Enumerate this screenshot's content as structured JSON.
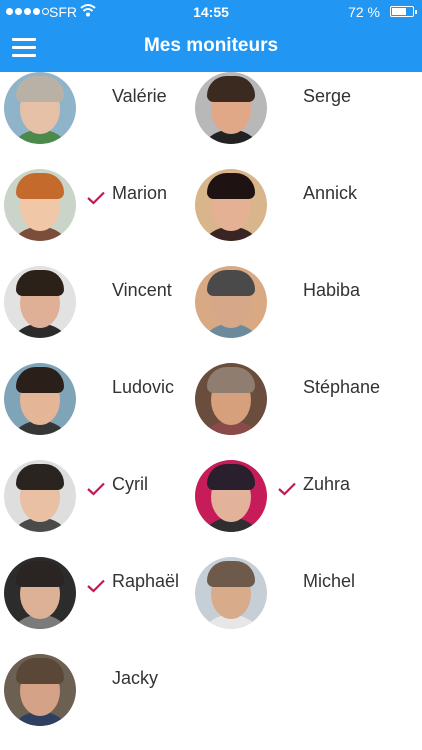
{
  "status": {
    "carrier": "SFR",
    "time": "14:55",
    "battery": "72 %",
    "battery_level": 0.72
  },
  "header": {
    "title": "Mes moniteurs"
  },
  "accent": "#2196f3",
  "check_color": "#c2185b",
  "monitors": [
    {
      "name": "Valérie",
      "checked": false,
      "bg": "#8fb3c9",
      "hair": "#b9b1a5",
      "skin": "#e7c1a7",
      "body": "#4b8a4b"
    },
    {
      "name": "Serge",
      "checked": false,
      "bg": "#b8b8b8",
      "hair": "#3a2a20",
      "skin": "#e1a888",
      "body": "#222222"
    },
    {
      "name": "Marion",
      "checked": true,
      "bg": "#cbd4c9",
      "hair": "#c46a2c",
      "skin": "#f0c8a8",
      "body": "#7a4e3a"
    },
    {
      "name": "Annick",
      "checked": false,
      "bg": "#d8b58a",
      "hair": "#1e1212",
      "skin": "#e5b195",
      "body": "#3b2424"
    },
    {
      "name": "Vincent",
      "checked": false,
      "bg": "#e2e2e2",
      "hair": "#2b2119",
      "skin": "#dfb096",
      "body": "#2b2b2b"
    },
    {
      "name": "Habiba",
      "checked": false,
      "bg": "#d9a984",
      "hair": "#4a4a4a",
      "skin": "#d7a789",
      "body": "#6b8b9c"
    },
    {
      "name": "Ludovic",
      "checked": false,
      "bg": "#7fa4b8",
      "hair": "#2a1f19",
      "skin": "#e5b597",
      "body": "#363636"
    },
    {
      "name": "Stéphane",
      "checked": false,
      "bg": "#6a4d3c",
      "hair": "#8f7d70",
      "skin": "#d6a07c",
      "body": "#8a4a4a"
    },
    {
      "name": "Cyril",
      "checked": true,
      "bg": "#dedede",
      "hair": "#2a2420",
      "skin": "#e9c0a3",
      "body": "#4a4a4a"
    },
    {
      "name": "Zuhra",
      "checked": true,
      "bg": "#c71c5a",
      "hair": "#2a1f2d",
      "skin": "#e3b29a",
      "body": "#2f2f2f"
    },
    {
      "name": "Raphaël",
      "checked": true,
      "bg": "#2c2c2c",
      "hair": "#2a2422",
      "skin": "#dcb195",
      "body": "#7b7b7b"
    },
    {
      "name": "Michel",
      "checked": false,
      "bg": "#c7cfd6",
      "hair": "#6e5a4a",
      "skin": "#d8ab8b",
      "body": "#e7e7e7"
    },
    {
      "name": "Jacky",
      "checked": false,
      "bg": "#6b6052",
      "hair": "#5b4738",
      "skin": "#d4a287",
      "body": "#2f3f5f"
    }
  ]
}
